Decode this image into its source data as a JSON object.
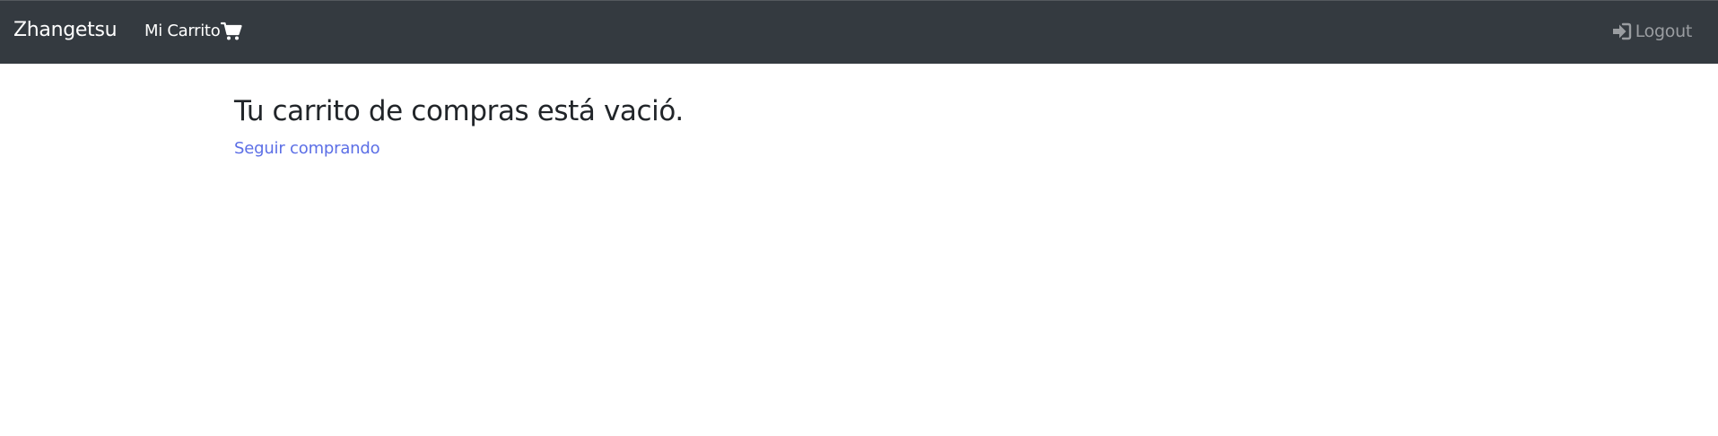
{
  "navbar": {
    "brand": "Zhangetsu",
    "cart_label": "Mi Carrito",
    "cart_icon": "shopping-cart-icon",
    "logout_label": "Logout",
    "logout_icon": "sign-in-icon",
    "background_color": "#343a40",
    "link_color": "#ffffff",
    "muted_link_color": "#9a9da1"
  },
  "main": {
    "heading": "Tu carrito de compras está vació.",
    "continue_link": "Seguir comprando",
    "link_color": "#5c6fe6"
  }
}
